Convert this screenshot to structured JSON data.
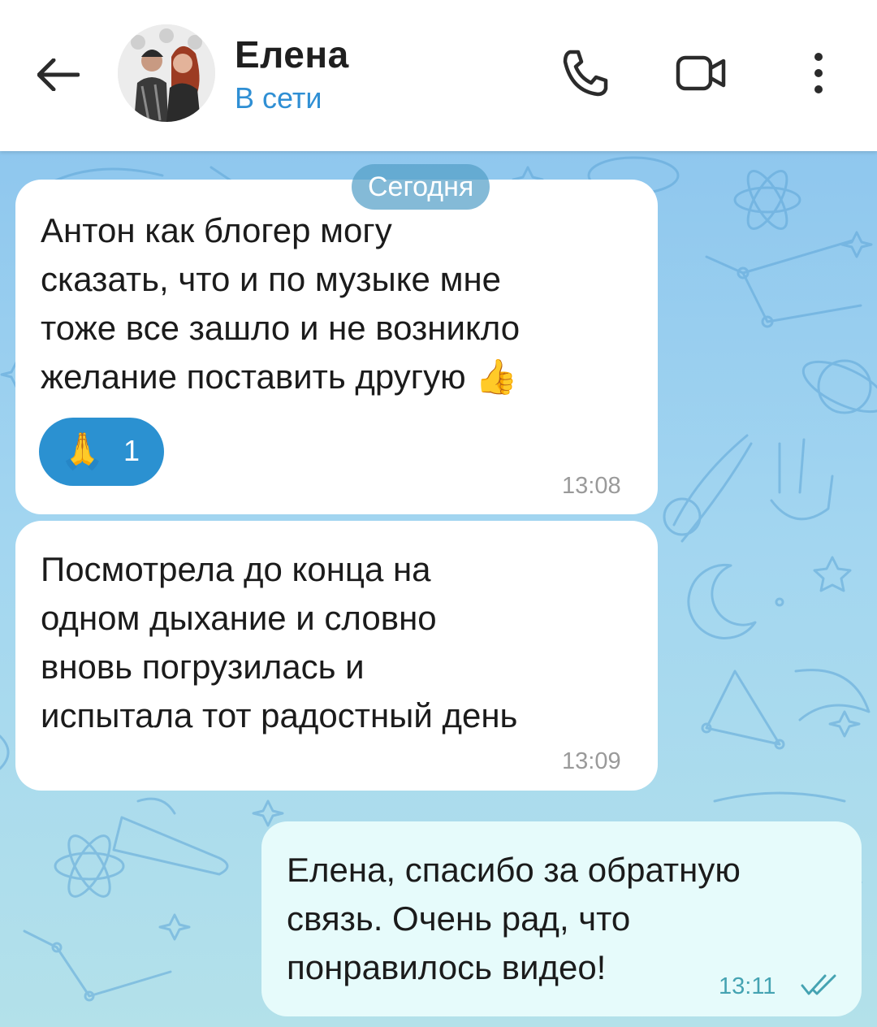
{
  "header": {
    "contact_name": "Елена",
    "status": "В сети"
  },
  "chat": {
    "date_label": "Сегодня",
    "messages": [
      {
        "direction": "incoming",
        "text": "Антон как блогер могу\nсказать,  что и по музыке мне\nтоже все зашло и не возникло\nжелание поставить другую",
        "trailing_emoji": "👍",
        "time": "13:08",
        "reaction": {
          "emoji": "🙏",
          "count": "1"
        }
      },
      {
        "direction": "incoming",
        "text": "Посмотрела до конца на\nодном дыхание и словно\nвновь погрузилась и\nиспытала тот радостный день",
        "time": "13:09"
      },
      {
        "direction": "outgoing",
        "text": "Елена, спасибо за обратную\nсвязь. Очень рад, что\nпонравилось видео!",
        "time": "13:11",
        "read_status": "double-check"
      }
    ]
  },
  "icons": {
    "back": "arrow-left-icon",
    "call": "phone-icon",
    "video": "video-camera-icon",
    "menu": "more-vertical-icon",
    "read": "double-check-icon"
  },
  "colors": {
    "accent": "#2f8fd4",
    "reaction_bg": "#2b91d1",
    "outgoing_bubble": "#e6fbfb",
    "outgoing_time": "#45a3b2"
  }
}
